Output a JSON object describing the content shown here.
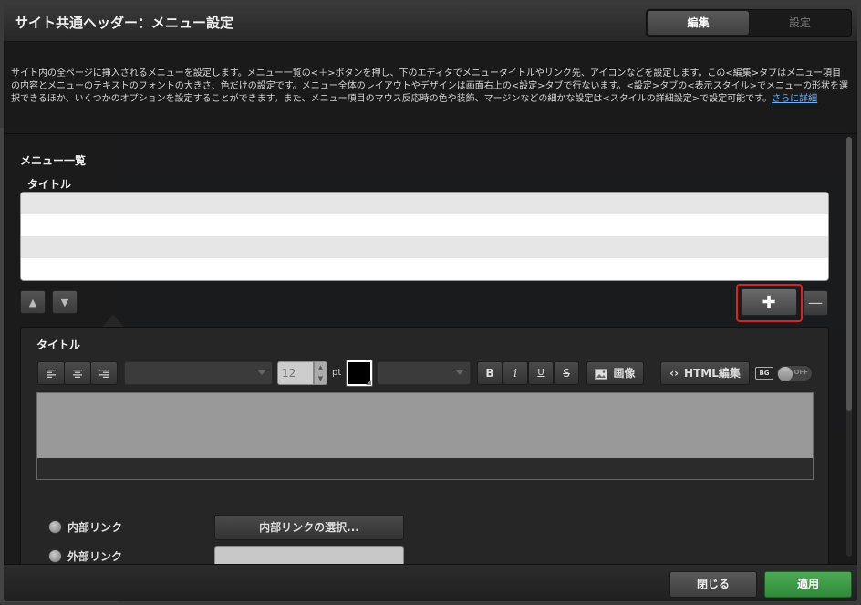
{
  "window": {
    "title": "サイト共通ヘッダー：メニュー設定",
    "tabs": [
      {
        "label": "編集",
        "active": true
      },
      {
        "label": "設定",
        "active": false
      }
    ]
  },
  "description": {
    "text": "サイト内の全ページに挿入されるメニューを設定します。メニュー一覧の<＋>ボタンを押し、下のエディタでメニュータイトルやリンク先、アイコンなどを設定します。この<編集>タブはメニュー項目の内容とメニューのテキストのフォントの大きさ、色だけの設定です。メニュー全体のレイアウトやデザインは画面右上の<設定>タブで行ないます。<設定>タブの<表示スタイル>でメニューの形状を選択できるほか、いくつかのオプションを設定することができます。また、メニュー項目のマウス反応時の色や装飾、マージンなどの細かな設定は<スタイルの詳細設定>で設定可能です。",
    "link": "さらに詳細"
  },
  "menu_list": {
    "heading": "メニュー一覧",
    "column_title": "タイトル",
    "rows": [
      "",
      "",
      "",
      ""
    ]
  },
  "list_controls": {
    "up_glyph": "▲",
    "down_glyph": "▼",
    "add_glyph": "✚",
    "remove_glyph": "—"
  },
  "editor": {
    "label": "タイトル",
    "font_size": "12",
    "size_unit": "pt",
    "bold": "B",
    "italic": "i",
    "underline": "U",
    "strike": "S",
    "image_button": "画像",
    "html_button": "HTML編集",
    "bg_badge": "BG",
    "toggle_state": "OFF"
  },
  "link_settings": {
    "internal_label": "内部リンク",
    "external_label": "外部リンク",
    "internal_select_button": "内部リンクの選択..."
  },
  "footer": {
    "close_label": "閉じる",
    "apply_label": "適用"
  },
  "colors": {
    "apply_green": "#3a9a45",
    "highlight_red": "#dd2222",
    "link_blue": "#6fb3ff"
  }
}
